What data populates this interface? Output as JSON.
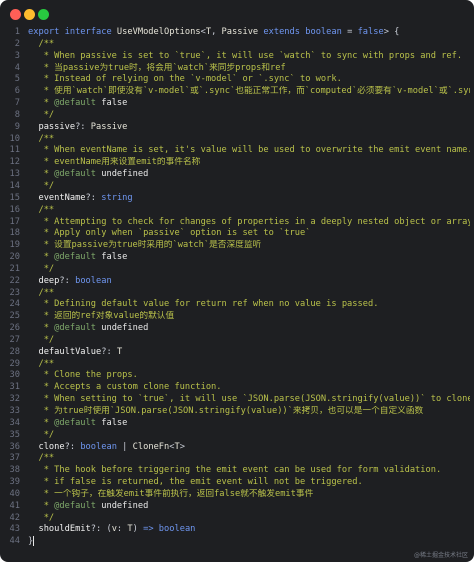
{
  "window": {
    "controls": [
      {
        "name": "close",
        "color": "#ff5f57"
      },
      {
        "name": "minimize",
        "color": "#febc2e"
      },
      {
        "name": "zoom",
        "color": "#28c840"
      }
    ]
  },
  "colors": {
    "background": "#1e1f22",
    "keyword": "#6f96f0",
    "comment": "#b9c14a",
    "tag": "#7ea86a",
    "line_number": "#6b7080"
  },
  "watermark": "@稀土掘金技术社区",
  "code": {
    "lines": [
      {
        "n": "1",
        "tokens": [
          {
            "t": "kw",
            "v": "export interface "
          },
          {
            "t": "type",
            "v": "UseVModelOptions"
          },
          {
            "t": "op",
            "v": "<"
          },
          {
            "t": "type",
            "v": "T"
          },
          {
            "t": "op",
            "v": ", "
          },
          {
            "t": "type",
            "v": "Passive "
          },
          {
            "t": "kw",
            "v": "extends "
          },
          {
            "t": "kw",
            "v": "boolean"
          },
          {
            "t": "op",
            "v": " = "
          },
          {
            "t": "bool",
            "v": "false"
          },
          {
            "t": "op",
            "v": "> {"
          }
        ]
      },
      {
        "n": "2",
        "tokens": [
          {
            "t": "cmt",
            "v": "  /**"
          }
        ]
      },
      {
        "n": "3",
        "tokens": [
          {
            "t": "cmt",
            "v": "   * When passive is set to `true`, it will use `watch` to sync with props and ref."
          }
        ]
      },
      {
        "n": "4",
        "tokens": [
          {
            "t": "cmt",
            "v": "   * 当passive为true时，将会用`watch`来同步props和ref"
          }
        ]
      },
      {
        "n": "5",
        "tokens": [
          {
            "t": "cmt",
            "v": "   * Instead of relying on the `v-model` or `.sync` to work."
          }
        ]
      },
      {
        "n": "6",
        "tokens": [
          {
            "t": "cmt",
            "v": "   * 使用`watch`即使没有`v-model`或`.sync`也能正常工作，而`computed`必须要有`v-model`或`.sync`"
          }
        ]
      },
      {
        "n": "7",
        "tokens": [
          {
            "t": "cmt",
            "v": "   * "
          },
          {
            "t": "ctag",
            "v": "@default "
          },
          {
            "t": "tagv",
            "v": "false"
          }
        ]
      },
      {
        "n": "8",
        "tokens": [
          {
            "t": "cmt",
            "v": "   */"
          }
        ]
      },
      {
        "n": "9",
        "tokens": [
          {
            "t": "prop",
            "v": "  passive"
          },
          {
            "t": "op",
            "v": "?: "
          },
          {
            "t": "type",
            "v": "Passive"
          }
        ]
      },
      {
        "n": "10",
        "tokens": [
          {
            "t": "cmt",
            "v": "  /**"
          }
        ]
      },
      {
        "n": "11",
        "tokens": [
          {
            "t": "cmt",
            "v": "   * When eventName is set, it's value will be used to overwrite the emit event name."
          }
        ]
      },
      {
        "n": "12",
        "tokens": [
          {
            "t": "cmt",
            "v": "   * eventName用来设置emit的事件名称"
          }
        ]
      },
      {
        "n": "13",
        "tokens": [
          {
            "t": "cmt",
            "v": "   * "
          },
          {
            "t": "ctag",
            "v": "@default "
          },
          {
            "t": "tagv",
            "v": "undefined"
          }
        ]
      },
      {
        "n": "14",
        "tokens": [
          {
            "t": "cmt",
            "v": "   */"
          }
        ]
      },
      {
        "n": "15",
        "tokens": [
          {
            "t": "prop",
            "v": "  eventName"
          },
          {
            "t": "op",
            "v": "?: "
          },
          {
            "t": "kw",
            "v": "string"
          }
        ]
      },
      {
        "n": "16",
        "tokens": [
          {
            "t": "cmt",
            "v": "  /**"
          }
        ]
      },
      {
        "n": "17",
        "tokens": [
          {
            "t": "cmt",
            "v": "   * Attempting to check for changes of properties in a deeply nested object or array."
          }
        ]
      },
      {
        "n": "18",
        "tokens": [
          {
            "t": "cmt",
            "v": "   * Apply only when `passive` option is set to `true`"
          }
        ]
      },
      {
        "n": "19",
        "tokens": [
          {
            "t": "cmt",
            "v": "   * 设置passive为true时采用的`watch`是否深度监听"
          }
        ]
      },
      {
        "n": "20",
        "tokens": [
          {
            "t": "cmt",
            "v": "   * "
          },
          {
            "t": "ctag",
            "v": "@default "
          },
          {
            "t": "tagv",
            "v": "false"
          }
        ]
      },
      {
        "n": "21",
        "tokens": [
          {
            "t": "cmt",
            "v": "   */"
          }
        ]
      },
      {
        "n": "22",
        "tokens": [
          {
            "t": "prop",
            "v": "  deep"
          },
          {
            "t": "op",
            "v": "?: "
          },
          {
            "t": "kw",
            "v": "boolean"
          }
        ]
      },
      {
        "n": "23",
        "tokens": [
          {
            "t": "cmt",
            "v": "  /**"
          }
        ]
      },
      {
        "n": "24",
        "tokens": [
          {
            "t": "cmt",
            "v": "   * Defining default value for return ref when no value is passed."
          }
        ]
      },
      {
        "n": "25",
        "tokens": [
          {
            "t": "cmt",
            "v": "   * 返回的ref对象value的默认值"
          }
        ]
      },
      {
        "n": "26",
        "tokens": [
          {
            "t": "cmt",
            "v": "   * "
          },
          {
            "t": "ctag",
            "v": "@default "
          },
          {
            "t": "tagv",
            "v": "undefined"
          }
        ]
      },
      {
        "n": "27",
        "tokens": [
          {
            "t": "cmt",
            "v": "   */"
          }
        ]
      },
      {
        "n": "28",
        "tokens": [
          {
            "t": "prop",
            "v": "  defaultValue"
          },
          {
            "t": "op",
            "v": "?: "
          },
          {
            "t": "type",
            "v": "T"
          }
        ]
      },
      {
        "n": "29",
        "tokens": [
          {
            "t": "cmt",
            "v": "  /**"
          }
        ]
      },
      {
        "n": "30",
        "tokens": [
          {
            "t": "cmt",
            "v": "   * Clone the props."
          }
        ]
      },
      {
        "n": "31",
        "tokens": [
          {
            "t": "cmt",
            "v": "   * Accepts a custom clone function."
          }
        ]
      },
      {
        "n": "32",
        "tokens": [
          {
            "t": "cmt",
            "v": "   * When setting to `true`, it will use `JSON.parse(JSON.stringify(value))` to clone."
          }
        ]
      },
      {
        "n": "33",
        "tokens": [
          {
            "t": "cmt",
            "v": "   * 为true时使用`JSON.parse(JSON.stringify(value))`来拷贝，也可以是一个自定义函数"
          }
        ]
      },
      {
        "n": "34",
        "tokens": [
          {
            "t": "cmt",
            "v": "   * "
          },
          {
            "t": "ctag",
            "v": "@default "
          },
          {
            "t": "tagv",
            "v": "false"
          }
        ]
      },
      {
        "n": "35",
        "tokens": [
          {
            "t": "cmt",
            "v": "   */"
          }
        ]
      },
      {
        "n": "36",
        "tokens": [
          {
            "t": "prop",
            "v": "  clone"
          },
          {
            "t": "op",
            "v": "?: "
          },
          {
            "t": "kw",
            "v": "boolean"
          },
          {
            "t": "op",
            "v": " | "
          },
          {
            "t": "type",
            "v": "CloneFn"
          },
          {
            "t": "op",
            "v": "<"
          },
          {
            "t": "type",
            "v": "T"
          },
          {
            "t": "op",
            "v": ">"
          }
        ]
      },
      {
        "n": "37",
        "tokens": [
          {
            "t": "cmt",
            "v": "  /**"
          }
        ]
      },
      {
        "n": "38",
        "tokens": [
          {
            "t": "cmt",
            "v": "   * The hook before triggering the emit event can be used for form validation."
          }
        ]
      },
      {
        "n": "39",
        "tokens": [
          {
            "t": "cmt",
            "v": "   * if false is returned, the emit event will not be triggered."
          }
        ]
      },
      {
        "n": "40",
        "tokens": [
          {
            "t": "cmt",
            "v": "   * 一个钩子，在触发emit事件前执行，返回false就不触发emit事件"
          }
        ]
      },
      {
        "n": "41",
        "tokens": [
          {
            "t": "cmt",
            "v": "   * "
          },
          {
            "t": "ctag",
            "v": "@default "
          },
          {
            "t": "tagv",
            "v": "undefined"
          }
        ]
      },
      {
        "n": "42",
        "tokens": [
          {
            "t": "cmt",
            "v": "   */"
          }
        ]
      },
      {
        "n": "43",
        "tokens": [
          {
            "t": "prop",
            "v": "  shouldEmit"
          },
          {
            "t": "op",
            "v": "?: ("
          },
          {
            "t": "id",
            "v": "v"
          },
          {
            "t": "op",
            "v": ": "
          },
          {
            "t": "type",
            "v": "T"
          },
          {
            "t": "op",
            "v": ") "
          },
          {
            "t": "kw",
            "v": "=> "
          },
          {
            "t": "kw",
            "v": "boolean"
          }
        ]
      },
      {
        "n": "44",
        "tokens": [
          {
            "t": "op",
            "v": "}"
          },
          {
            "t": "cursor",
            "v": ""
          }
        ]
      }
    ]
  }
}
